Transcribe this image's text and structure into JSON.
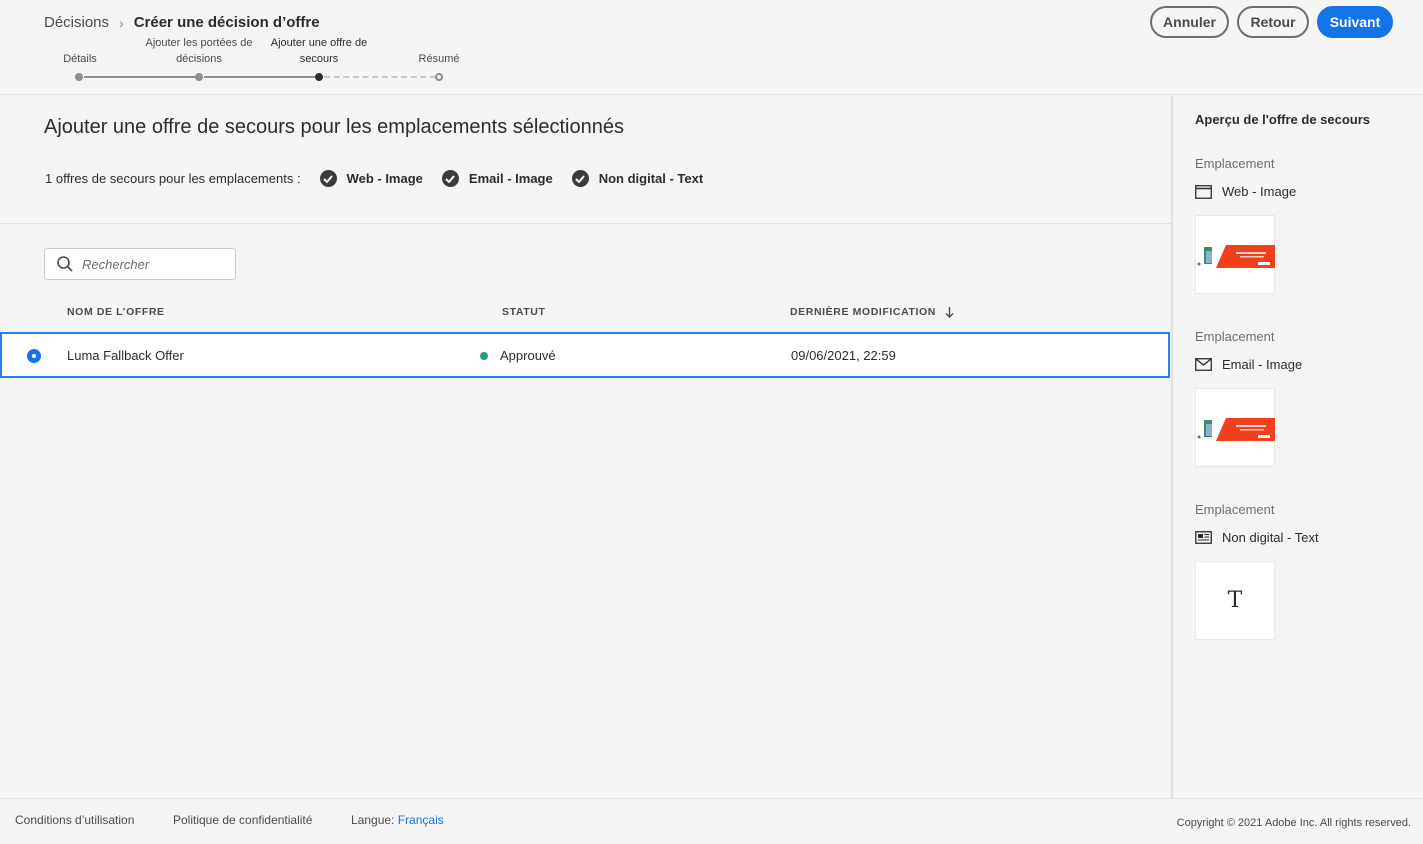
{
  "breadcrumb": {
    "root": "Décisions",
    "separator": "›",
    "current": "Créer une décision d’offre"
  },
  "stepper": {
    "steps": [
      {
        "label": "Détails",
        "state": "done"
      },
      {
        "label": "Ajouter les portées de décisions",
        "state": "done"
      },
      {
        "label": "Ajouter une offre de secours",
        "state": "active"
      },
      {
        "label": "Résumé",
        "state": "todo"
      }
    ]
  },
  "actions": {
    "cancel": "Annuler",
    "back": "Retour",
    "next": "Suivant"
  },
  "main": {
    "title": "Ajouter une offre de secours pour les emplacements sélectionnés",
    "placements_summary": "1 offres de secours pour les emplacements :",
    "placements": [
      "Web - Image",
      "Email - Image",
      "Non digital - Text"
    ],
    "search": {
      "placeholder": "Rechercher"
    },
    "table": {
      "columns": [
        "NOM DE L’OFFRE",
        "STATUT",
        "DERNIÈRE MODIFICATION"
      ],
      "sort_icon": "arrow-down-icon",
      "rows": [
        {
          "name": "Luma Fallback Offer",
          "status": "Approuvé",
          "modified": "09/06/2021, 22:59",
          "selected": true
        }
      ]
    }
  },
  "preview": {
    "title": "Aperçu de l'offre de secours",
    "items": [
      {
        "label": "Emplacement",
        "placement": "Web - Image",
        "icon": "browser-window-icon",
        "kind": "image"
      },
      {
        "label": "Emplacement",
        "placement": "Email - Image",
        "icon": "envelope-icon",
        "kind": "image"
      },
      {
        "label": "Emplacement",
        "placement": "Non digital - Text",
        "icon": "newspaper-icon",
        "kind": "text",
        "glyph": "T"
      }
    ]
  },
  "footer": {
    "terms": "Conditions d’utilisation",
    "privacy": "Politique de confidentialité",
    "language_label": "Langue:",
    "language_value": "Français",
    "copyright": "Copyright ©  2021 Adobe Inc.  All rights reserved."
  },
  "colors": {
    "accent": "#1473e6",
    "status_approved": "#2d9d78",
    "banner_red": "#f0401e"
  }
}
